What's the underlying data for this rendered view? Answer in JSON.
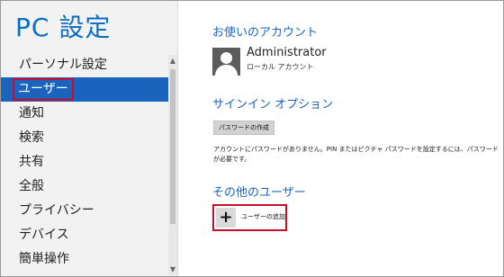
{
  "app": {
    "title": "PC 設定"
  },
  "nav": {
    "items": [
      {
        "label": "パーソナル設定"
      },
      {
        "label": "ユーザー"
      },
      {
        "label": "通知"
      },
      {
        "label": "検索"
      },
      {
        "label": "共有"
      },
      {
        "label": "全般"
      },
      {
        "label": "プライバシー"
      },
      {
        "label": "デバイス"
      },
      {
        "label": "簡単操作"
      }
    ],
    "selected": "ユーザー"
  },
  "account": {
    "heading": "お使いのアカウント",
    "user_name": "Administrator",
    "user_type": "ローカル アカウント",
    "avatar_icon": "user-avatar-icon"
  },
  "signin": {
    "heading": "サインイン オプション",
    "create_password_button": "パスワードの作成",
    "note": "アカウントにパスワードがありません。PIN またはピクチャ パスワードを設定するには、パスワードが必要です。"
  },
  "other_users": {
    "heading": "その他のユーザー",
    "add_user_label": "ユーザーの追加",
    "add_icon": "plus-icon"
  },
  "colors": {
    "accent": "#1b64bd",
    "title": "#0a6ec4",
    "highlight_border": "#c8102e"
  }
}
